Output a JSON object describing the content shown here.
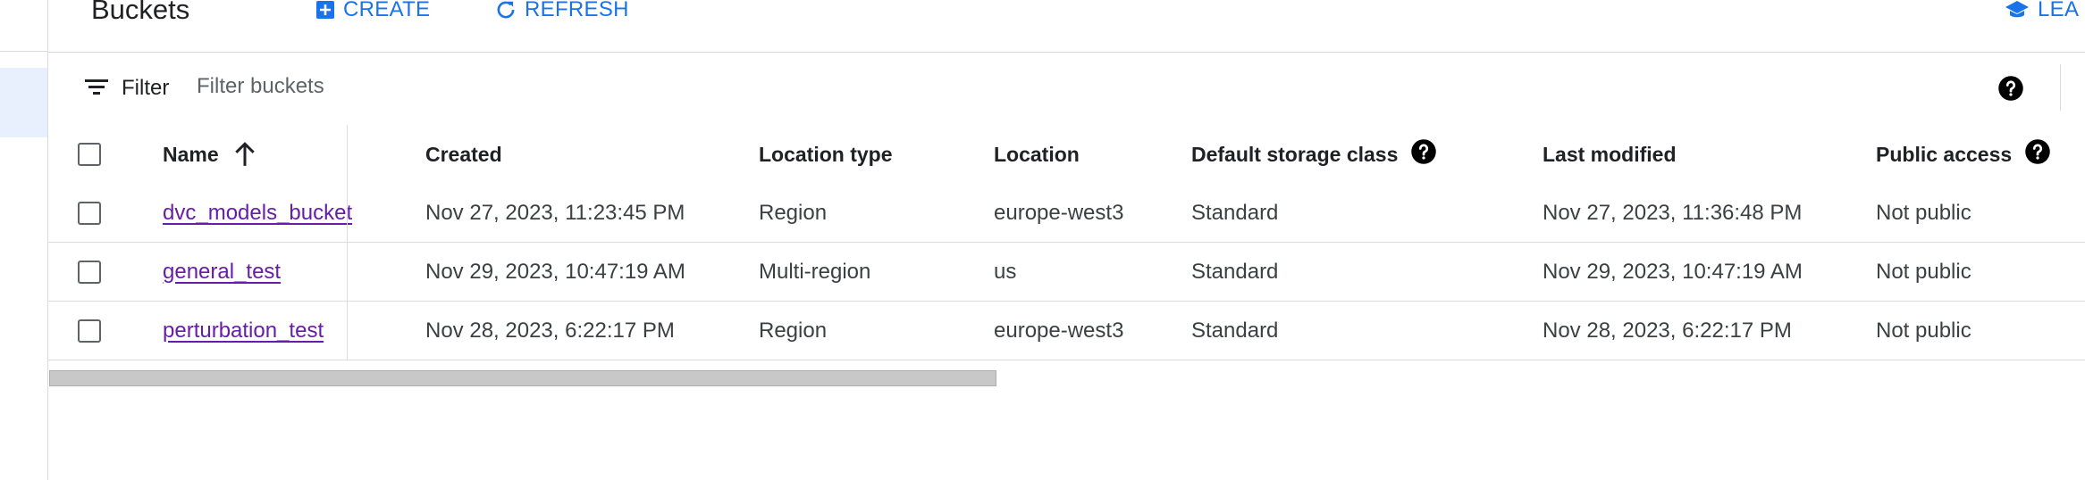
{
  "header": {
    "title": "Buckets",
    "create_label": "CREATE",
    "refresh_label": "REFRESH",
    "learn_label": "LEA"
  },
  "filter": {
    "label": "Filter",
    "placeholder": "Filter buckets"
  },
  "table": {
    "columns": {
      "name": "Name",
      "created": "Created",
      "location_type": "Location type",
      "location": "Location",
      "storage_class": "Default storage class",
      "last_modified": "Last modified",
      "public_access": "Public access"
    },
    "rows": [
      {
        "name": "dvc_models_bucket",
        "created": "Nov 27, 2023, 11:23:45 PM",
        "location_type": "Region",
        "location": "europe-west3",
        "storage_class": "Standard",
        "last_modified": "Nov 27, 2023, 11:36:48 PM",
        "public_access": "Not public"
      },
      {
        "name": "general_test",
        "created": "Nov 29, 2023, 10:47:19 AM",
        "location_type": "Multi-region",
        "location": "us",
        "storage_class": "Standard",
        "last_modified": "Nov 29, 2023, 10:47:19 AM",
        "public_access": "Not public"
      },
      {
        "name": "perturbation_test",
        "created": "Nov 28, 2023, 6:22:17 PM",
        "location_type": "Region",
        "location": "europe-west3",
        "storage_class": "Standard",
        "last_modified": "Nov 28, 2023, 6:22:17 PM",
        "public_access": "Not public"
      }
    ]
  },
  "icons": {
    "create": "add-box-icon",
    "refresh": "refresh-icon",
    "learn": "school-icon",
    "filter": "filter-list-icon",
    "help": "help-circle-icon",
    "sort": "arrow-upward-icon"
  },
  "colors": {
    "accent": "#1a73e8",
    "link": "#681da8",
    "divider": "#dadce0"
  }
}
